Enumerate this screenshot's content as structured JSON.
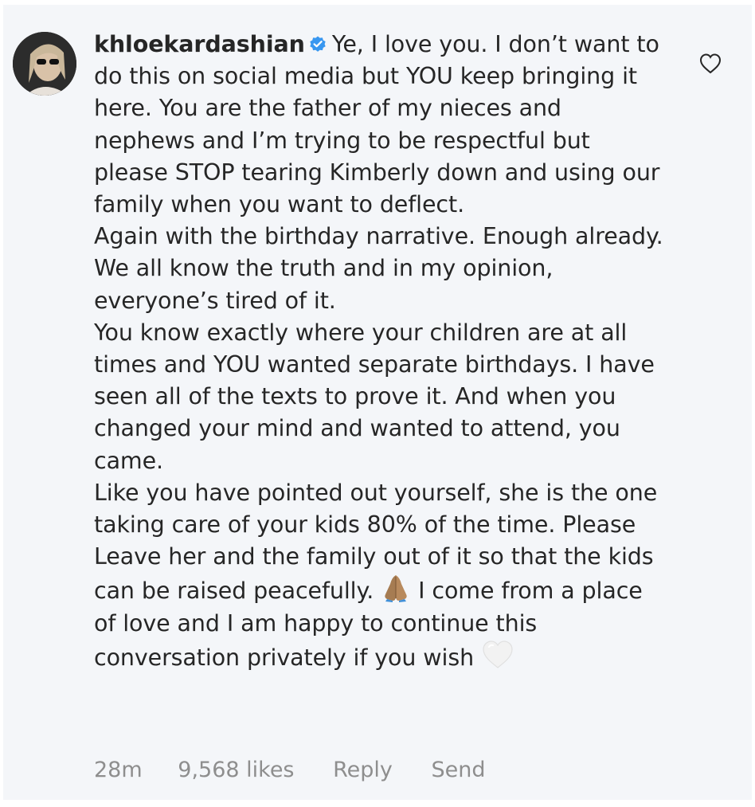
{
  "comment": {
    "username": "khloekardashian",
    "verified_icon": "verified-badge-icon",
    "paragraphs": [
      "Ye, I love you. I don’t want to do this on social media but YOU keep bringing it here. You are the father of my nieces and nephews and I’m trying to be respectful but please STOP tearing Kimberly down and using our family when you want to deflect.",
      "Again with the birthday narrative. Enough already. We all know the truth and in my opinion, everyone’s tired of it.",
      "You know exactly where your children are at all times and YOU wanted separate birthdays. I have seen all of the texts to prove it. And when you changed your mind and wanted to attend, you came.",
      "Like you have pointed out yourself, she is the one taking care of your kids 80% of the time. Please Leave her and the family out of it so that the kids can be raised peacefully."
    ],
    "p4_after_emoji": "I come from a place of love and I am happy to continue this conversation privately if you wish",
    "emoji_1": "folded-hands-emoji",
    "emoji_2": "white-heart-emoji"
  },
  "meta": {
    "time": "28m",
    "likes": "9,568 likes",
    "reply": "Reply",
    "send": "Send"
  },
  "colors": {
    "background": "#f4f6f9",
    "text": "#262626",
    "secondary_text": "#8e8e8e",
    "verified_blue": "#3897f0"
  }
}
